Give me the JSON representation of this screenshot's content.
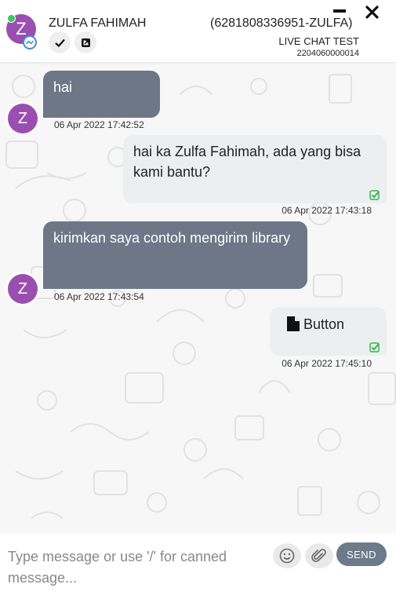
{
  "header": {
    "avatar_initial": "Z",
    "contact_name": "ZULFA FAHIMAH",
    "contact_phone": "(6281808336951-ZULFA)",
    "account_name": "LIVE CHAT TEST",
    "account_id": "2204060000014",
    "icons": [
      "check-icon",
      "external-window-icon",
      "minimize-icon",
      "close-icon",
      "chat-channel-icon"
    ]
  },
  "messages": [
    {
      "direction": "incoming",
      "text": "hai",
      "time": "06 Apr 2022 17:42:52",
      "avatar": "Z"
    },
    {
      "direction": "outgoing",
      "text": "hai ka Zulfa Fahimah, ada yang bisa kami bantu?",
      "time": "06 Apr 2022 17:43:18",
      "status": "read"
    },
    {
      "direction": "incoming",
      "text": "kirimkan saya contoh mengirim library",
      "time": "06 Apr 2022 17:43:54",
      "avatar": "Z"
    },
    {
      "direction": "outgoing",
      "text": "Button",
      "time": "06 Apr 2022 17:45:10",
      "status": "read",
      "icon": "file-icon"
    }
  ],
  "composer": {
    "placeholder": "Type message or use '/' for canned message...",
    "send_label": "SEND",
    "icons": [
      "emoji-icon",
      "attachment-icon"
    ]
  },
  "colors": {
    "avatar": "#9a4fb0",
    "incoming_bubble": "#6d7787",
    "outgoing_bubble": "#eceff0",
    "online": "#3cc46a",
    "read_check": "#2fb84a",
    "send_button": "#6c7a89"
  }
}
